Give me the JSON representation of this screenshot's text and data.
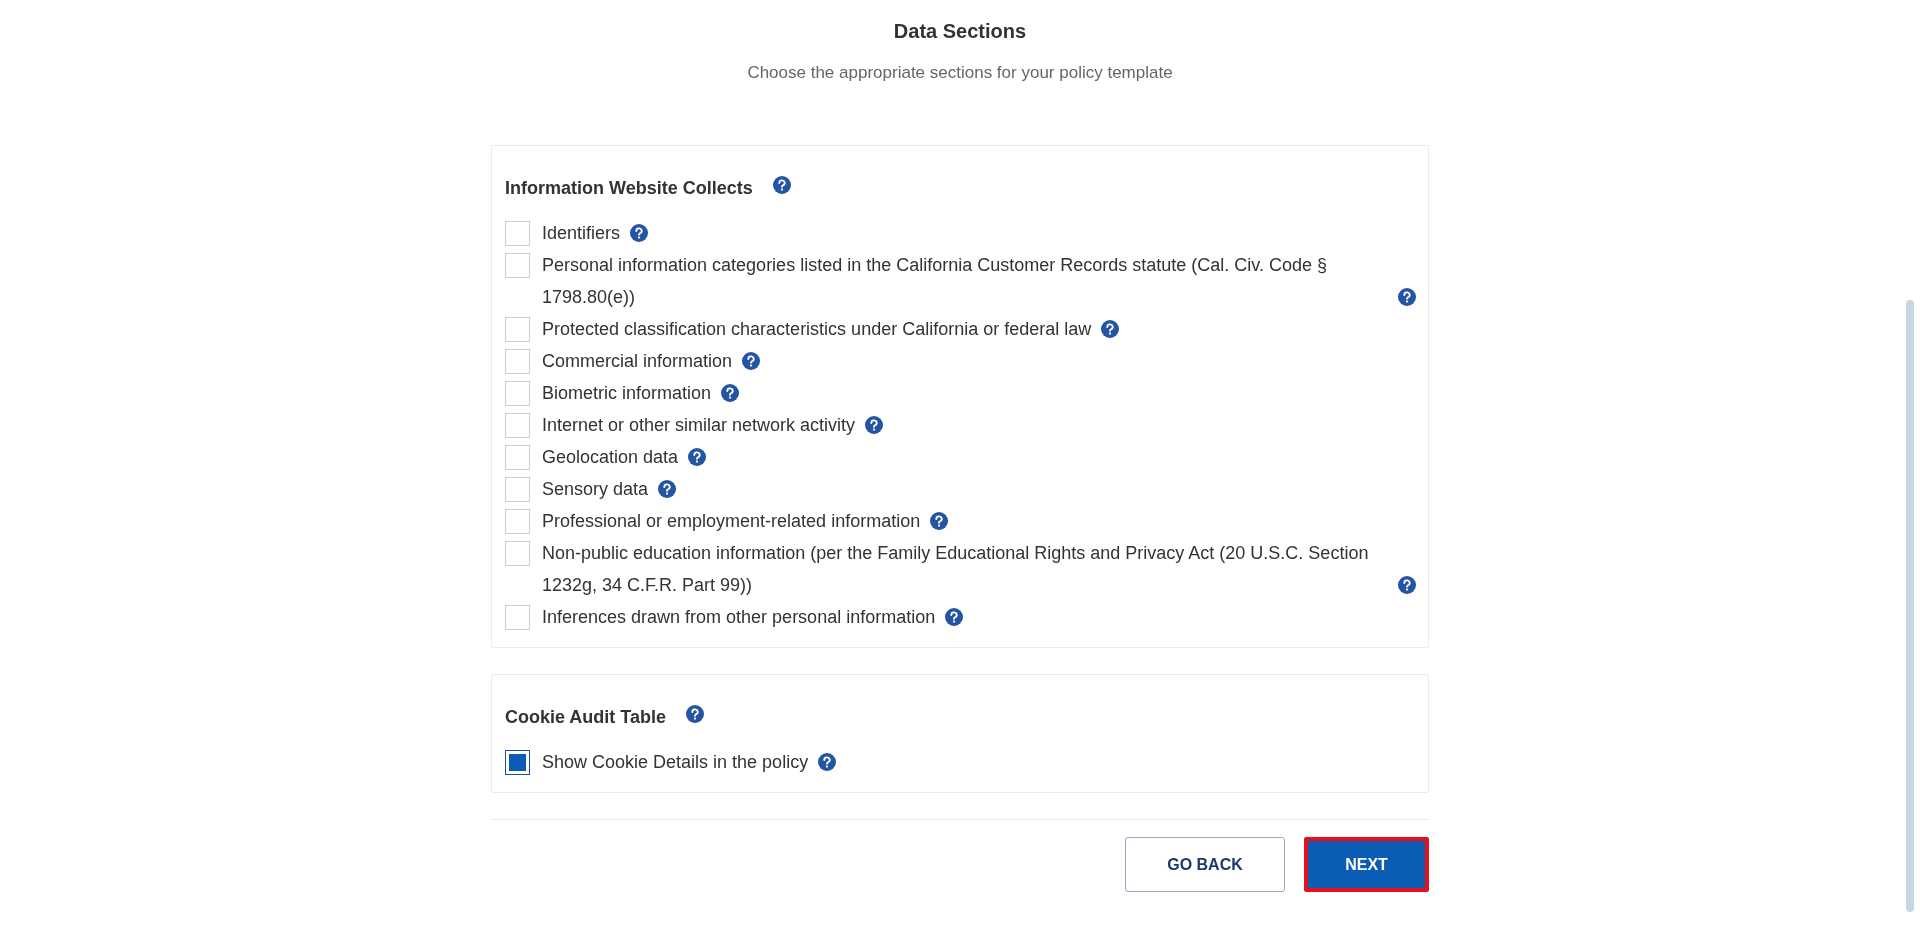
{
  "header": {
    "title": "Data Sections",
    "subtitle": "Choose the appropriate sections for your policy template"
  },
  "sections": [
    {
      "title": "Information Website Collects",
      "items": [
        {
          "label": "Identifiers",
          "checked": false
        },
        {
          "label": "Personal information categories listed in the California Customer Records statute (Cal. Civ. Code § 1798.80(e))",
          "checked": false
        },
        {
          "label": "Protected classification characteristics under California or federal law",
          "checked": false
        },
        {
          "label": "Commercial information",
          "checked": false
        },
        {
          "label": "Biometric information",
          "checked": false
        },
        {
          "label": "Internet or other similar network activity",
          "checked": false
        },
        {
          "label": "Geolocation data",
          "checked": false
        },
        {
          "label": "Sensory data",
          "checked": false
        },
        {
          "label": "Professional or employment-related information",
          "checked": false
        },
        {
          "label": "Non-public education information (per the Family Educational Rights and Privacy Act (20 U.S.C. Section 1232g, 34 C.F.R. Part 99))",
          "checked": false
        },
        {
          "label": "Inferences drawn from other personal information",
          "checked": false
        }
      ]
    },
    {
      "title": "Cookie Audit Table",
      "items": [
        {
          "label": "Show Cookie Details in the policy",
          "checked": true
        }
      ]
    }
  ],
  "buttons": [
    {
      "label": "GO BACK",
      "kind": "secondary",
      "highlighted": false
    },
    {
      "label": "NEXT",
      "kind": "primary",
      "highlighted": true
    }
  ]
}
